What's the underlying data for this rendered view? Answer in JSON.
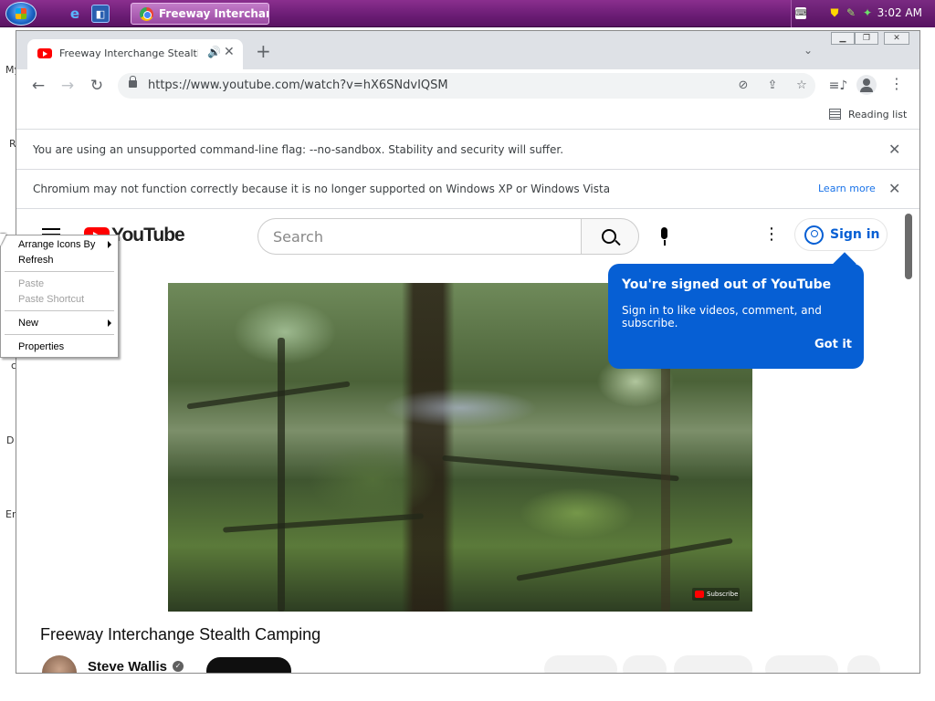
{
  "taskbar": {
    "task_button_label": "Freeway Interchang...",
    "clock": "3:02 AM"
  },
  "desktop": {
    "icon_label_fragments": [
      "My",
      "R",
      "D",
      "Er",
      "c"
    ]
  },
  "browser": {
    "tab_title": "Freeway Interchange Stealth Camping",
    "url": "https://www.youtube.com/watch?v=hX6SNdvIQSM",
    "reading_list_label": "Reading list",
    "infobar_flag": "You are using an unsupported command-line flag: --no-sandbox. Stability and security will suffer.",
    "infobar_os": "Chromium may not function correctly because it is no longer supported on Windows XP or Windows Vista",
    "learn_more": "Learn more"
  },
  "youtube": {
    "logo_text": "YouTube",
    "search_placeholder": "Search",
    "sign_in": "Sign in",
    "tooltip": {
      "title": "You're signed out of YouTube",
      "body": "Sign in to like videos, comment, and subscribe.",
      "button": "Got it"
    },
    "video_overlay_subscribe": "Subscribe",
    "video_title": "Freeway Interchange Stealth Camping",
    "channel_name": "Steve Wallis"
  },
  "context_menu": {
    "items": [
      {
        "label": "Arrange Icons By",
        "enabled": true,
        "submenu": true
      },
      {
        "label": "Refresh",
        "enabled": true,
        "submenu": false
      },
      {
        "label": "Paste",
        "enabled": false,
        "submenu": false
      },
      {
        "label": "Paste Shortcut",
        "enabled": false,
        "submenu": false
      },
      {
        "label": "New",
        "enabled": true,
        "submenu": true
      },
      {
        "label": "Properties",
        "enabled": true,
        "submenu": false
      }
    ]
  },
  "colors": {
    "taskbar": "#6a1c74",
    "youtube_red": "#ff0000",
    "youtube_blue": "#065fd4",
    "link_blue": "#1a73e8"
  }
}
